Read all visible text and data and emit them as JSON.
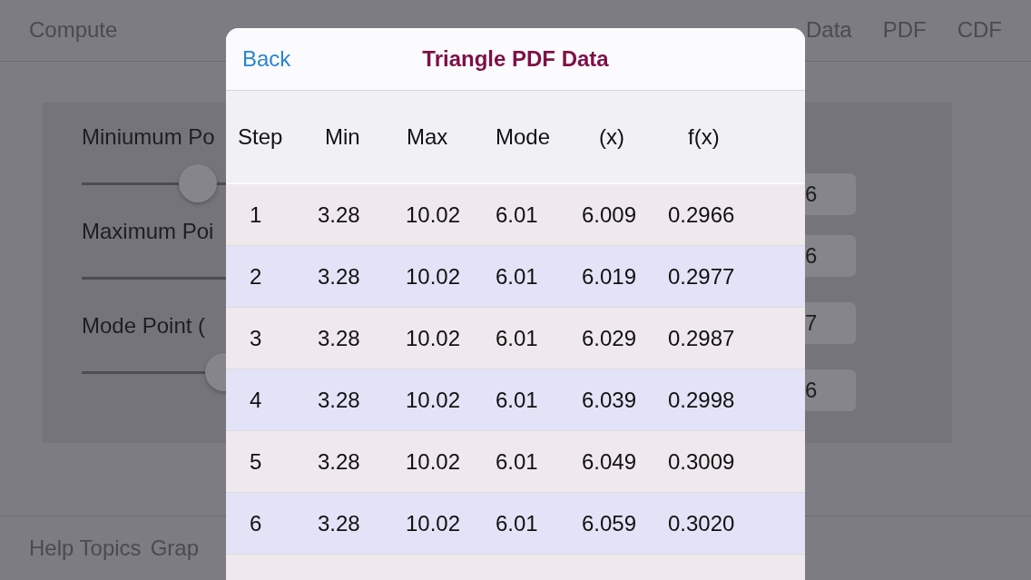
{
  "nav_bar": {
    "left": "Compute",
    "right_items": [
      "Data",
      "PDF",
      "CDF"
    ]
  },
  "parameters": [
    {
      "label": "Miniumum Po",
      "level": 0.4
    },
    {
      "label": "Maximum Poi"
    },
    {
      "label": "Mode Point ( ",
      "level": 0.49
    }
  ],
  "value_fields": [
    "6",
    "6",
    "7",
    "6"
  ],
  "bottom_toolbar": [
    "Help Topics",
    "Grap"
  ],
  "modal": {
    "back": "Back",
    "title": "Triangle PDF Data",
    "columns": [
      "Step",
      "Min",
      "Max",
      "Mode",
      "(x)",
      "f(x)"
    ],
    "rows": [
      [
        "1",
        "3.28",
        "10.02",
        "6.01",
        "6.009",
        "0.2966"
      ],
      [
        "2",
        "3.28",
        "10.02",
        "6.01",
        "6.019",
        "0.2977"
      ],
      [
        "3",
        "3.28",
        "10.02",
        "6.01",
        "6.029",
        "0.2987"
      ],
      [
        "4",
        "3.28",
        "10.02",
        "6.01",
        "6.039",
        "0.2998"
      ],
      [
        "5",
        "3.28",
        "10.02",
        "6.01",
        "6.049",
        "0.3009"
      ],
      [
        "6",
        "3.28",
        "10.02",
        "6.01",
        "6.059",
        "0.3020"
      ]
    ]
  }
}
